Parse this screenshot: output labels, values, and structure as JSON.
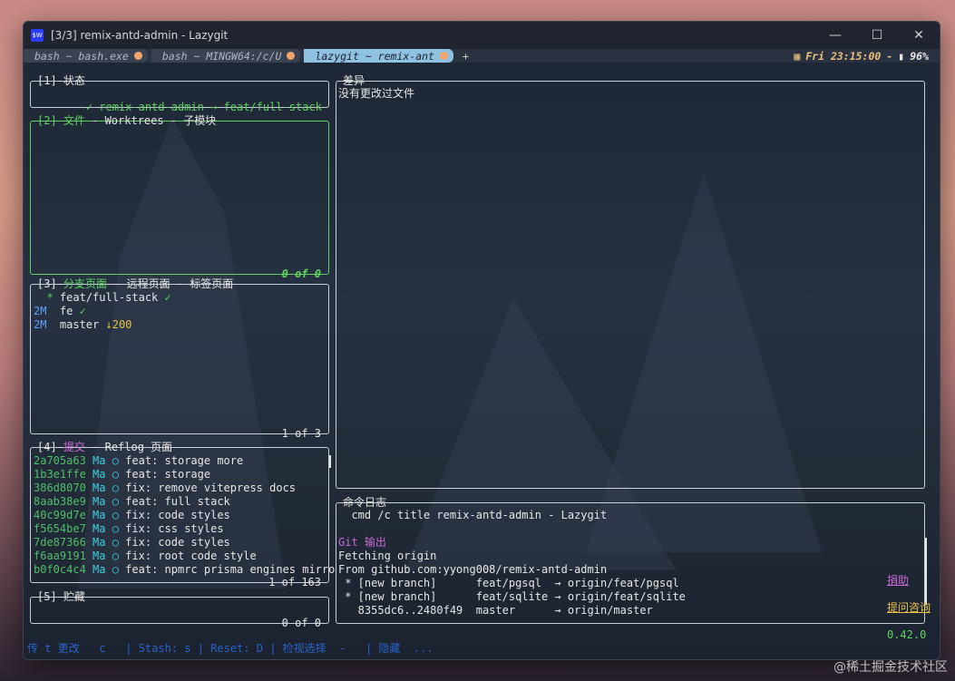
{
  "window": {
    "title": "[3/3] remix-antd-admin - Lazygit",
    "icon": "$W"
  },
  "tabs": [
    {
      "label": "bash ~ bash.exe"
    },
    {
      "label": "bash ~ MINGW64:/c/U"
    },
    {
      "label": "lazygit ~ remix-ant"
    }
  ],
  "tab_plus": "+",
  "status": {
    "datetime": "Fri 23:15:00",
    "separator": "-",
    "battery": "96%"
  },
  "status_panel": {
    "title": "[1]-状态",
    "repo": "✓ remix-antd-admin → feat/full-stack"
  },
  "files_panel": {
    "title_num": "[2]-文件",
    "title_rest": " - Worktrees - 子模块",
    "footer": "0 of 0"
  },
  "branches_panel": {
    "title_num": "[3]-",
    "title_active": "分支页面",
    "title_rest": " - 远程页面 - 标签页面",
    "rows": [
      {
        "prefix": "  * ",
        "name": "feat/full-stack",
        "suffix": " ✓"
      },
      {
        "prefix": "2M  ",
        "name": "fe",
        "suffix": " ✓"
      },
      {
        "prefix": "2M  ",
        "name": "master",
        "suffix": " ↓200"
      }
    ],
    "footer": "1 of 3"
  },
  "commits_panel": {
    "title_num": "[4]-",
    "title_active": "提交",
    "title_rest": " - Reflog 页面",
    "rows": [
      {
        "hash": "2a705a63",
        "author": "Ma",
        "msg": "feat: storage more"
      },
      {
        "hash": "1b3e1ffe",
        "author": "Ma",
        "msg": "feat: storage"
      },
      {
        "hash": "386d8070",
        "author": "Ma",
        "msg": "fix: remove vitepress docs"
      },
      {
        "hash": "8aab38e9",
        "author": "Ma",
        "msg": "feat: full stack"
      },
      {
        "hash": "40c99d7e",
        "author": "Ma",
        "msg": "fix: code styles"
      },
      {
        "hash": "f5654be7",
        "author": "Ma",
        "msg": "fix: css styles"
      },
      {
        "hash": "7de87366",
        "author": "Ma",
        "msg": "fix: code styles"
      },
      {
        "hash": "f6aa9191",
        "author": "Ma",
        "msg": "fix: root code style"
      },
      {
        "hash": "b0f0c4c4",
        "author": "Ma",
        "msg": "feat: npmrc prisma engines mirro"
      }
    ],
    "footer": "1 of 163"
  },
  "stash_panel": {
    "title": "[5]-贮藏",
    "footer": "0 of 0"
  },
  "diff_panel": {
    "title": "差异",
    "body": "没有更改过文件"
  },
  "log_panel": {
    "title": "命令日志",
    "lines": [
      "  cmd /c title remix-antd-admin - Lazygit",
      "",
      "Git 输出",
      "Fetching origin",
      "From github.com:yyong008/remix-antd-admin",
      " * [new branch]      feat/pgsql  → origin/feat/pgsql",
      " * [new branch]      feat/sqlite → origin/feat/sqlite",
      "   8355dc6..2480f49  master      → origin/master"
    ]
  },
  "keybindings": "传 t 更改   c   | Stash: s | Reset: D | 检视选择  -   | 隐藏  ...",
  "bottom_right": {
    "donate": "捐助",
    "ask": "提问咨询",
    "version": "0.42.0"
  },
  "watermark": "@稀土掘金技术社区",
  "colors": {
    "active_border": "#5fd35f",
    "tab_active": "#8fc1e0",
    "accent_yellow": "#e9c17d"
  }
}
